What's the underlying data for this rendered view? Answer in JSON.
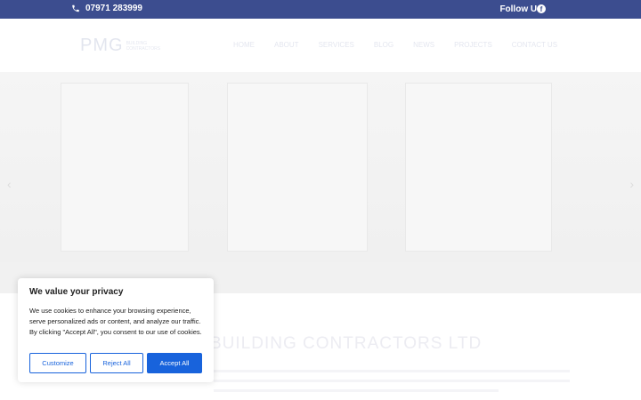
{
  "topbar": {
    "phone": "07971 283999",
    "follow": "Follow Us:",
    "social_icon": "f"
  },
  "header": {
    "logo_text": "PMG",
    "logo_sub_1": "BUILDING",
    "logo_sub_2": "CONTRACTORS",
    "nav": [
      "HOME",
      "ABOUT",
      "SERVICES",
      "BLOG",
      "NEWS",
      "PROJECTS",
      "CONTACT US"
    ]
  },
  "hero": {
    "prev_arrow": "‹",
    "next_arrow": "›"
  },
  "section": {
    "title": "BUILDING CONTRACTORS LTD"
  },
  "cookie": {
    "title": "We value your privacy",
    "body": "We use cookies to enhance your browsing experience, serve personalized ads or content, and analyze our traffic. By clicking \"Accept All\", you consent to our use of cookies.",
    "customize": "Customize",
    "reject": "Reject All",
    "accept": "Accept All"
  },
  "colors": {
    "brand": "#3c4d8f",
    "accent": "#1863dc"
  }
}
